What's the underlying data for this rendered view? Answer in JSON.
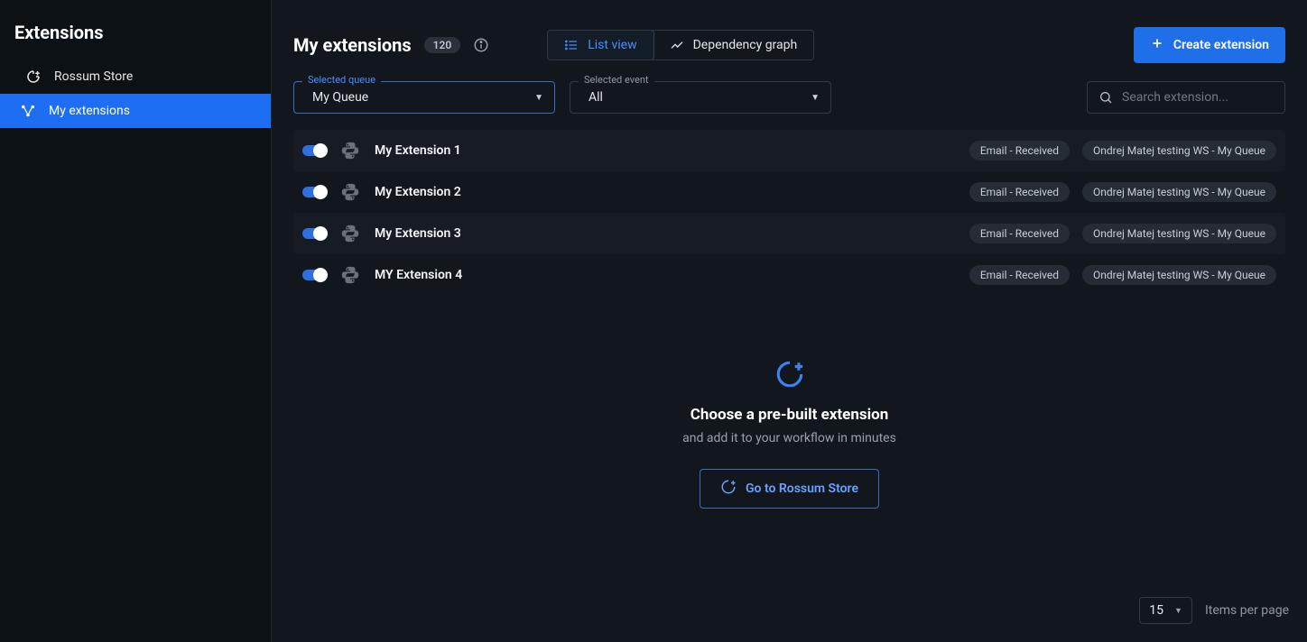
{
  "sidebar": {
    "title": "Extensions",
    "items": [
      {
        "label": "Rossum Store",
        "icon": "store-icon"
      },
      {
        "label": "My extensions",
        "icon": "graph-icon"
      }
    ],
    "active_index": 1
  },
  "header": {
    "title": "My extensions",
    "count": "120",
    "tabs": [
      {
        "label": "List view"
      },
      {
        "label": "Dependency graph"
      }
    ],
    "active_tab": 0,
    "create_label": "Create extension"
  },
  "filters": {
    "queue_label": "Selected queue",
    "queue_value": "My Queue",
    "event_label": "Selected event",
    "event_value": "All",
    "search_placeholder": "Search extension..."
  },
  "extensions": [
    {
      "name": "My Extension 1",
      "event_tag": "Email - Received",
      "queue_tag": "Ondrej Matej testing WS - My Queue"
    },
    {
      "name": "My Extension 2",
      "event_tag": "Email - Received",
      "queue_tag": "Ondrej Matej testing WS - My Queue"
    },
    {
      "name": "My Extension 3",
      "event_tag": "Email - Received",
      "queue_tag": "Ondrej Matej testing WS - My Queue"
    },
    {
      "name": "MY Extension 4",
      "event_tag": "Email - Received",
      "queue_tag": "Ondrej Matej testing WS - My Queue"
    }
  ],
  "empty": {
    "title": "Choose a pre-built extension",
    "subtitle": "and add it to your workflow in minutes",
    "button": "Go to Rossum Store"
  },
  "footer": {
    "page_size": "15",
    "label": "Items per page"
  }
}
